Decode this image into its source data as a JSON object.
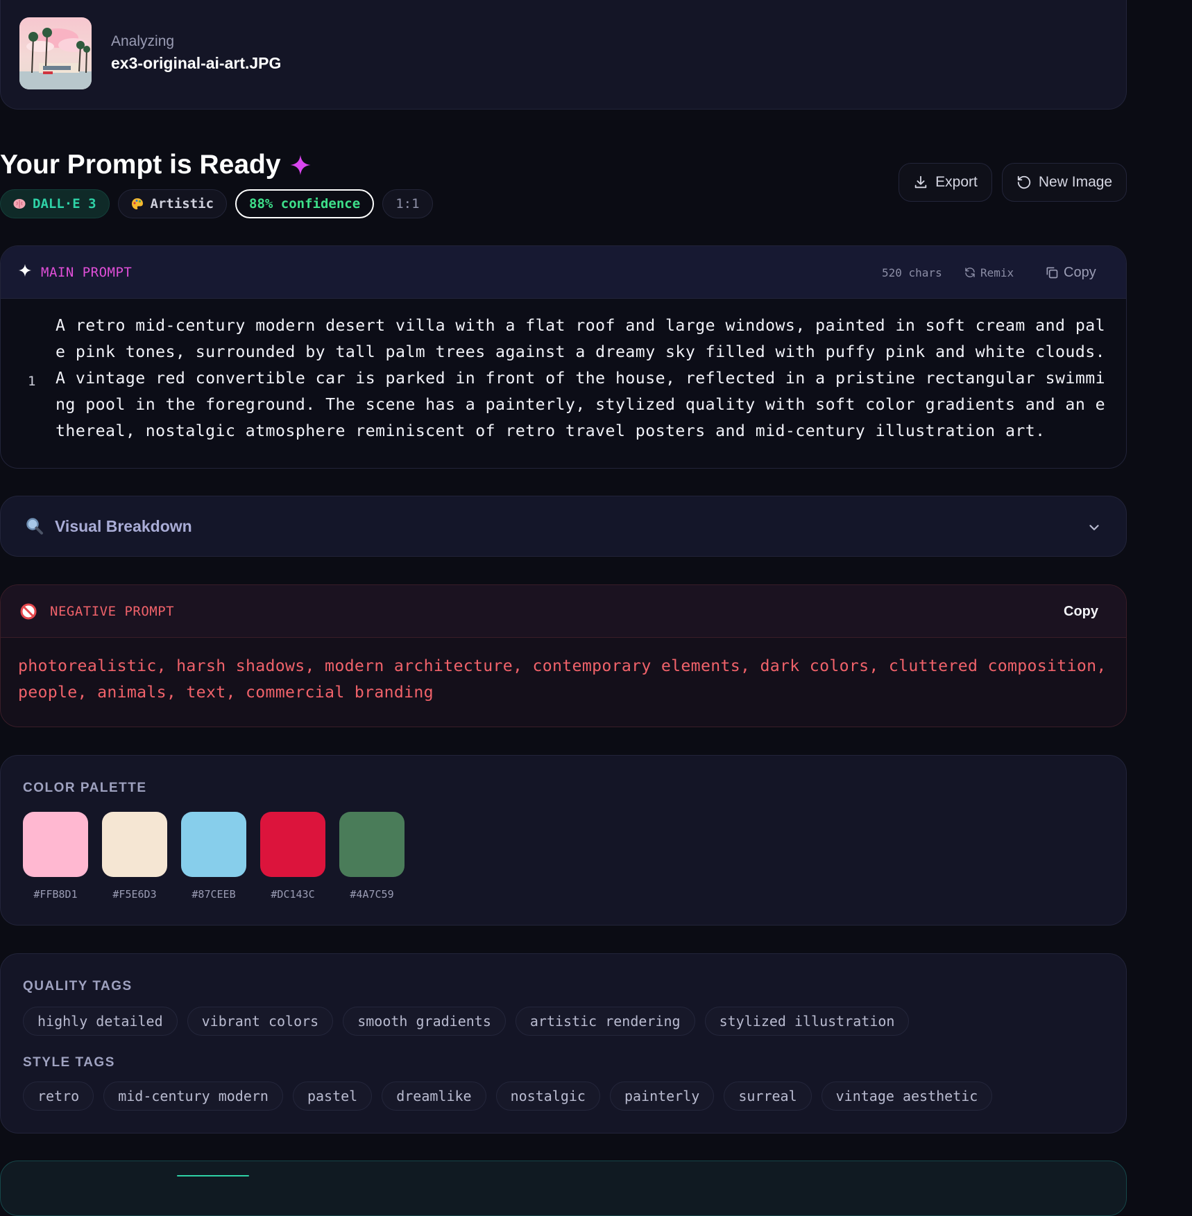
{
  "header": {
    "analyzing_label": "Analyzing",
    "file_name": "ex3-original-ai-art.JPG"
  },
  "title": {
    "text": "Your Prompt is Ready",
    "sparkle_color": "#d946ef"
  },
  "badges": {
    "model": "DALL·E 3",
    "style": "Artistic",
    "confidence": "88% confidence",
    "ratio": "1:1"
  },
  "actions": {
    "export_label": "Export",
    "new_image_label": "New Image"
  },
  "main_prompt": {
    "label": "MAIN PROMPT",
    "chars": "520 chars",
    "remix_label": "Remix",
    "copy_label": "Copy",
    "line_number": "1",
    "text": "A retro mid-century modern desert villa with a flat roof and large windows, painted in soft cream and pale pink tones, surrounded by tall palm trees against a dreamy sky filled with puffy pink and white clouds. A vintage red convertible car is parked in front of the house, reflected in a pristine rectangular swimming pool in the foreground. The scene has a painterly, stylized quality with soft color gradients and an ethereal, nostalgic atmosphere reminiscent of retro travel posters and mid-century illustration art."
  },
  "visual_breakdown": {
    "label": "Visual Breakdown"
  },
  "negative_prompt": {
    "label": "NEGATIVE PROMPT",
    "copy_label": "Copy",
    "text": "photorealistic, harsh shadows, modern architecture, contemporary elements, dark colors, cluttered composition, people, animals, text, commercial branding"
  },
  "color_palette": {
    "heading": "COLOR PALETTE",
    "colors": [
      {
        "hex": "#FFB8D1"
      },
      {
        "hex": "#F5E6D3"
      },
      {
        "hex": "#87CEEB"
      },
      {
        "hex": "#DC143C"
      },
      {
        "hex": "#4A7C59"
      }
    ]
  },
  "quality_tags": {
    "heading": "QUALITY TAGS",
    "items": [
      "highly detailed",
      "vibrant colors",
      "smooth gradients",
      "artistic rendering",
      "stylized illustration"
    ]
  },
  "style_tags": {
    "heading": "STYLE TAGS",
    "items": [
      "retro",
      "mid-century modern",
      "pastel",
      "dreamlike",
      "nostalgic",
      "painterly",
      "surreal",
      "vintage aesthetic"
    ]
  }
}
